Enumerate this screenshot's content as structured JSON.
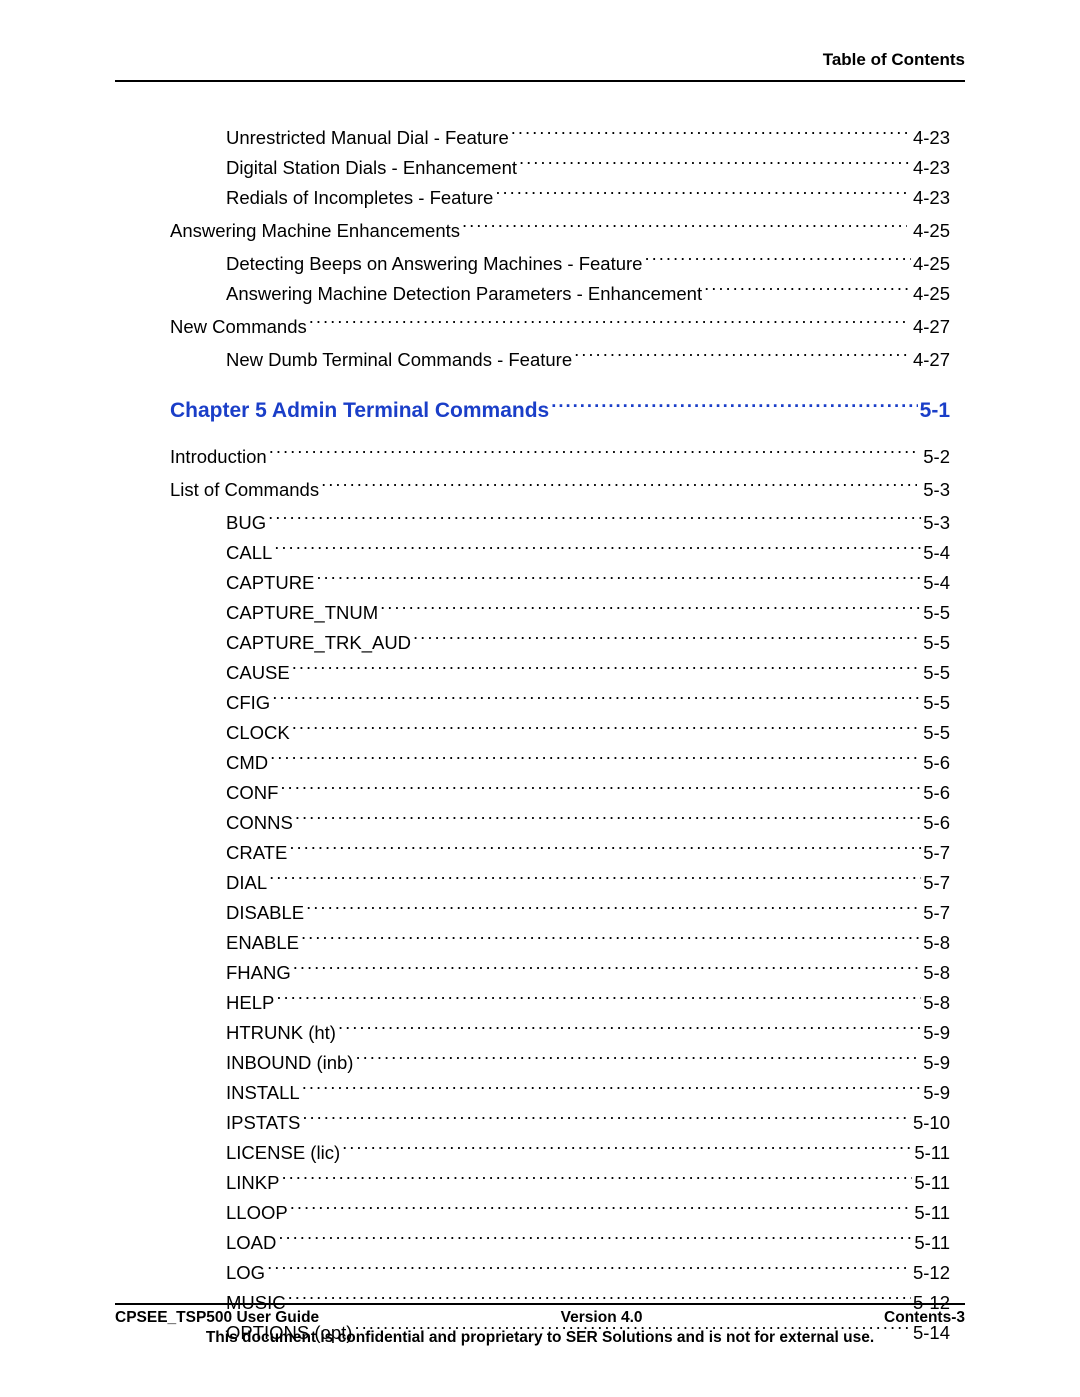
{
  "header": {
    "title": "Table of Contents"
  },
  "toc": [
    {
      "level": 2,
      "label": "Unrestricted Manual Dial - Feature",
      "page": "4-23"
    },
    {
      "level": 2,
      "label": "Digital Station Dials - Enhancement",
      "page": "4-23"
    },
    {
      "level": 2,
      "label": "Redials of Incompletes - Feature",
      "page": "4-23"
    },
    {
      "level": 1,
      "label": "Answering Machine Enhancements",
      "page": "4-25"
    },
    {
      "level": 2,
      "label": "Detecting Beeps on Answering Machines - Feature",
      "page": "4-25"
    },
    {
      "level": 2,
      "label": "Answering Machine Detection Parameters - Enhancement",
      "page": "4-25"
    },
    {
      "level": 1,
      "label": "New Commands",
      "page": "4-27"
    },
    {
      "level": 2,
      "label": "New Dumb Terminal Commands - Feature",
      "page": "4-27"
    },
    {
      "chapter": true,
      "label": "Chapter 5 Admin Terminal Commands",
      "page": "5-1"
    },
    {
      "level": 1,
      "label": "Introduction",
      "page": "5-2"
    },
    {
      "level": 1,
      "label": "List of Commands",
      "page": "5-3"
    },
    {
      "level": 2,
      "label": "BUG",
      "page": "5-3"
    },
    {
      "level": 2,
      "label": "CALL",
      "page": "5-4"
    },
    {
      "level": 2,
      "label": "CAPTURE",
      "page": "5-4"
    },
    {
      "level": 2,
      "label": "CAPTURE_TNUM",
      "page": "5-5"
    },
    {
      "level": 2,
      "label": "CAPTURE_TRK_AUD",
      "page": "5-5"
    },
    {
      "level": 2,
      "label": "CAUSE",
      "page": "5-5"
    },
    {
      "level": 2,
      "label": "CFIG",
      "page": "5-5"
    },
    {
      "level": 2,
      "label": "CLOCK",
      "page": "5-5"
    },
    {
      "level": 2,
      "label": "CMD",
      "page": "5-6"
    },
    {
      "level": 2,
      "label": "CONF",
      "page": "5-6"
    },
    {
      "level": 2,
      "label": "CONNS",
      "page": "5-6"
    },
    {
      "level": 2,
      "label": "CRATE",
      "page": "5-7"
    },
    {
      "level": 2,
      "label": "DIAL",
      "page": "5-7"
    },
    {
      "level": 2,
      "label": "DISABLE",
      "page": "5-7"
    },
    {
      "level": 2,
      "label": "ENABLE",
      "page": "5-8"
    },
    {
      "level": 2,
      "label": "FHANG",
      "page": "5-8"
    },
    {
      "level": 2,
      "label": "HELP",
      "page": "5-8"
    },
    {
      "level": 2,
      "label": "HTRUNK (ht)",
      "page": "5-9"
    },
    {
      "level": 2,
      "label": "INBOUND (inb)",
      "page": "5-9"
    },
    {
      "level": 2,
      "label": "INSTALL",
      "page": "5-9"
    },
    {
      "level": 2,
      "label": "IPSTATS",
      "page": "5-10"
    },
    {
      "level": 2,
      "label": "LICENSE (lic)",
      "page": "5-11"
    },
    {
      "level": 2,
      "label": "LINKP",
      "page": "5-11"
    },
    {
      "level": 2,
      "label": "LLOOP",
      "page": "5-11"
    },
    {
      "level": 2,
      "label": "LOAD",
      "page": "5-11"
    },
    {
      "level": 2,
      "label": "LOG",
      "page": "5-12"
    },
    {
      "level": 2,
      "label": "MUSIC",
      "page": "5-12"
    },
    {
      "level": 2,
      "label": "OPTIONS (opt)",
      "page": "5-14"
    }
  ],
  "footer": {
    "left": "CPSEE_TSP500 User Guide",
    "center": "Version 4.0",
    "right": "Contents-3",
    "note": "This document is confidential and proprietary to SER Solutions and is not for external use."
  }
}
